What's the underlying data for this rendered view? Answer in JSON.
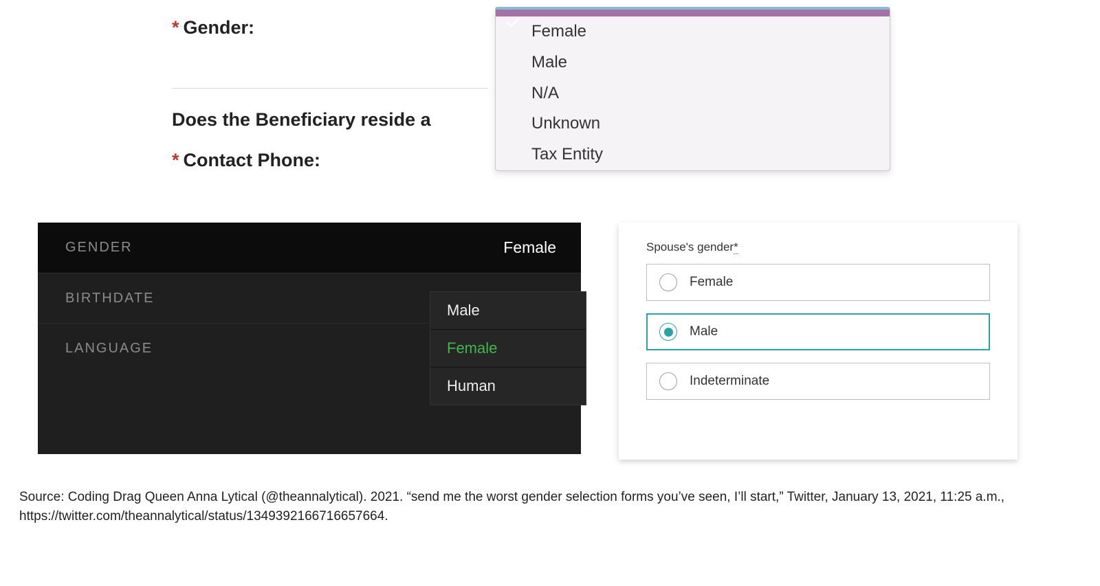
{
  "panel1": {
    "required_marker": "*",
    "gender_label": "Gender:",
    "beneficiary_question": "Does the Beneficiary reside a",
    "contact_label": "Contact Phone:",
    "dropdown": {
      "selected_blank": "",
      "options": [
        "Female",
        "Male",
        "N/A",
        "Unknown",
        "Tax Entity"
      ]
    }
  },
  "panel2": {
    "rows": [
      {
        "label": "GENDER",
        "value": "Female"
      },
      {
        "label": "BIRTHDATE",
        "value": ""
      },
      {
        "label": "LANGUAGE",
        "value": ""
      }
    ],
    "dropdown_options": [
      "Male",
      "Female",
      "Human"
    ],
    "dropdown_selected_index": 1
  },
  "panel3": {
    "label": "Spouse's gender",
    "label_suffix": "*",
    "options": [
      "Female",
      "Male",
      "Indeterminate"
    ],
    "selected_index": 1
  },
  "caption": {
    "line1": "Source: Coding Drag Queen Anna Lytical (@theannalytical). 2021. “send me the worst gender selection forms you’ve seen, I’ll start,” Twitter, January 13, 2021, 11:25 a.m.,",
    "line2": "https://twitter.com/theannalytical/status/1349392166716657664."
  }
}
